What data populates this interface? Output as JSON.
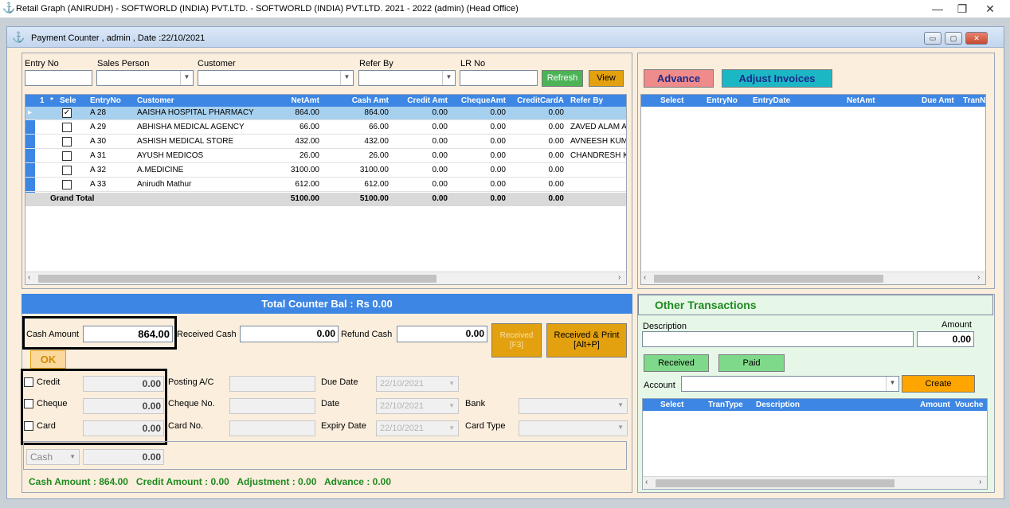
{
  "window": {
    "title": "Retail Graph (ANIRUDH) - SOFTWORLD (INDIA) PVT.LTD. - SOFTWORLD (INDIA) PVT.LTD.  2021 - 2022 (admin) (Head Office)",
    "minimize": "—",
    "restore": "❐",
    "close": "✕",
    "icon": "app-logo-icon"
  },
  "form": {
    "title": "Payment Counter , admin , Date :22/10/2021",
    "icon": "app-logo-icon"
  },
  "filters": {
    "entry_no_label": "Entry No",
    "sales_person_label": "Sales Person",
    "customer_label": "Customer",
    "refer_by_label": "Refer By",
    "lr_no_label": "LR No",
    "refresh_label": "Refresh",
    "view_label": "View"
  },
  "main_grid": {
    "headers": [
      "1",
      "*",
      "Sele",
      "EntryNo",
      "Customer",
      "NetAmt",
      "Cash Amt",
      "Credit Amt",
      "ChequeAmt",
      "CreditCardA",
      "Refer By"
    ],
    "rows": [
      {
        "checked": true,
        "entry": "A 28",
        "customer": "AAISHA HOSPITAL PHARMACY",
        "net": "864.00",
        "cash": "864.00",
        "credit": "0.00",
        "cheque": "0.00",
        "card": "0.00",
        "refer": ""
      },
      {
        "checked": false,
        "entry": "A 29",
        "customer": "ABHISHA MEDICAL AGENCY",
        "net": "66.00",
        "cash": "66.00",
        "credit": "0.00",
        "cheque": "0.00",
        "card": "0.00",
        "refer": "ZAVED ALAM A"
      },
      {
        "checked": false,
        "entry": "A 30",
        "customer": "ASHISH MEDICAL STORE",
        "net": "432.00",
        "cash": "432.00",
        "credit": "0.00",
        "cheque": "0.00",
        "card": "0.00",
        "refer": "AVNEESH KUM"
      },
      {
        "checked": false,
        "entry": "A 31",
        "customer": "AYUSH MEDICOS",
        "net": "26.00",
        "cash": "26.00",
        "credit": "0.00",
        "cheque": "0.00",
        "card": "0.00",
        "refer": "CHANDRESH K"
      },
      {
        "checked": false,
        "entry": "A 32",
        "customer": "A.MEDICINE",
        "net": "3100.00",
        "cash": "3100.00",
        "credit": "0.00",
        "cheque": "0.00",
        "card": "0.00",
        "refer": ""
      },
      {
        "checked": false,
        "entry": "A 33",
        "customer": "Anirudh Mathur",
        "net": "612.00",
        "cash": "612.00",
        "credit": "0.00",
        "cheque": "0.00",
        "card": "0.00",
        "refer": ""
      }
    ],
    "total": {
      "label": "Grand Total",
      "net": "5100.00",
      "cash": "5100.00",
      "credit": "0.00",
      "cheque": "0.00",
      "card": "0.00"
    }
  },
  "right_top": {
    "advance_label": "Advance",
    "adjust_label": "Adjust Invoices",
    "headers": [
      "Select",
      "EntryNo",
      "EntryDate",
      "NetAmt",
      "Due Amt",
      "TranNa"
    ]
  },
  "counter": {
    "total_bal": "Total Counter Bal : Rs 0.00",
    "cash_amount_label": "Cash Amount",
    "cash_amount_value": "864.00",
    "received_cash_label": "Received Cash",
    "received_cash_value": "0.00",
    "refund_cash_label": "Refund Cash",
    "refund_cash_value": "0.00",
    "received_btn": "Received\n[F3]",
    "received_btn_l1": "Received",
    "received_btn_l2": "[F3]",
    "received_print_l1": "Received & Print",
    "received_print_l2": "[Alt+P]",
    "ok_label": "OK",
    "credit_label": "Credit",
    "credit_value": "0.00",
    "cheque_label": "Cheque",
    "cheque_value": "0.00",
    "card_label": "Card",
    "card_value": "0.00",
    "posting_ac_label": "Posting A/C",
    "cheque_no_label": "Cheque No.",
    "card_no_label": "Card No.",
    "due_date_label": "Due Date",
    "due_date_value": "22/10/2021",
    "date_label": "Date",
    "date_value": "22/10/2021",
    "expiry_date_label": "Expiry Date",
    "expiry_date_value": "22/10/2021",
    "bank_label": "Bank",
    "card_type_label": "Card Type",
    "mode_value": "Cash",
    "mode_amount": "0.00",
    "summary": "Cash Amount : 864.00   Credit Amount : 0.00   Adjustment : 0.00   Advance : 0.00"
  },
  "other": {
    "title": "Other Transactions",
    "description_label": "Description",
    "amount_label": "Amount",
    "amount_value": "0.00",
    "received_label": "Received",
    "paid_label": "Paid",
    "account_label": "Account",
    "create_label": "Create",
    "headers": [
      "Select",
      "TranType",
      "Description",
      "Amount",
      "Vouche"
    ]
  },
  "colors": {
    "accent_blue": "#3d86e3",
    "green_button": "#4cb356",
    "gold_button": "#e3a10f",
    "pink_button": "#ef8b8b",
    "teal_button": "#1cb7c5"
  }
}
